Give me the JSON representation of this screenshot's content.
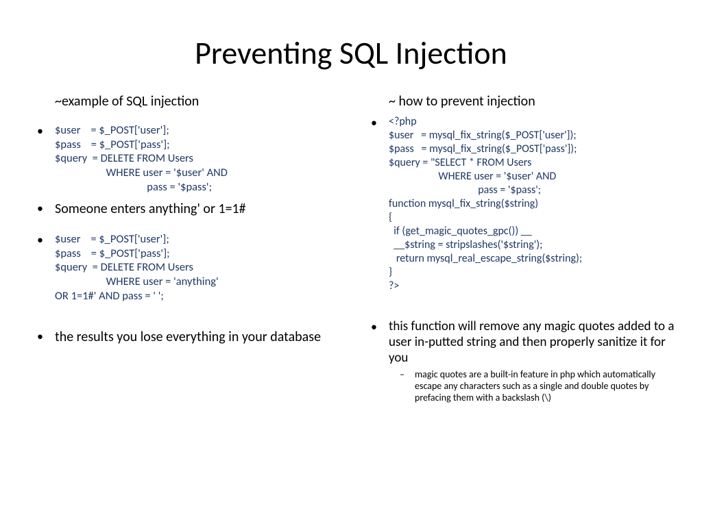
{
  "title": "Preventing SQL Injection",
  "left": {
    "heading": "~example of SQL injection",
    "code1": "$user    = $_POST['user'];\n$pass    = $_POST['pass'];\n$query  = DELETE FROM Users\n                    WHERE user = '$user' AND\n                                    pass = '$pass';",
    "bullet1": "Someone enters anything' or 1=1#",
    "code2": "$user    = $_POST['user'];\n$pass    = $_POST['pass'];\n$query  = DELETE FROM Users\n                    WHERE user = 'anything'\nOR 1=1#' AND pass = ' ';",
    "bullet2": "the results you lose everything in your database"
  },
  "right": {
    "heading": "~ how to prevent injection",
    "code1": "<?php\n$user   = mysql_fix_string($_POST['user']);\n$pass   = mysql_fix_string($_POST['pass']);\n$query = \"SELECT * FROM Users\n                    WHERE user = '$user' AND\n                                    pass = '$pass';\nfunction mysql_fix_string($string)\n{\n  if (get_magic_quotes_gpc()) __\n  __$string = stripslashes('$string');\n   return mysql_real_escape_string($string);\n}\n?>",
    "bullet1": "this function will remove any magic quotes added to a user in-putted string and then properly sanitize it for you",
    "sub1": "magic quotes are a built-in feature in php which automatically escape any characters such as a single and double quotes by prefacing them with a backslash (\\)"
  }
}
